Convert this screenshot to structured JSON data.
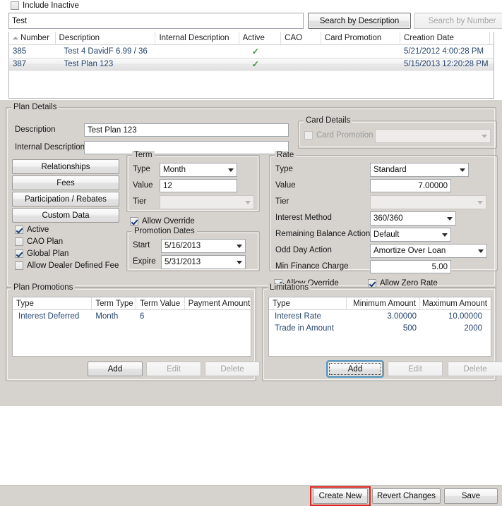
{
  "top": {
    "include_inactive_label": "Include Inactive",
    "include_inactive_checked": false,
    "search_value": "Test",
    "search_placeholder": "",
    "search_by_description_label": "Search by Description",
    "search_by_number_label": "Search by Number"
  },
  "results_grid": {
    "columns": [
      "Number",
      "Description",
      "Internal Description",
      "Active",
      "CAO",
      "Card Promotion",
      "Creation Date"
    ],
    "sort_column": "Number",
    "sort_direction": "ascending",
    "rows": [
      {
        "number": "385",
        "description": "Test 4 DavidF 6.99 / 36",
        "internal_description": "",
        "active": "✓",
        "cao": "",
        "card_promotion": "",
        "creation_date": "5/21/2012 4:00:28 PM",
        "selected": false
      },
      {
        "number": "387",
        "description": "Test Plan 123",
        "internal_description": "",
        "active": "✓",
        "cao": "",
        "card_promotion": "",
        "creation_date": "5/15/2013 12:20:28 PM",
        "selected": true
      }
    ]
  },
  "plan_details": {
    "title": "Plan Details",
    "description_label": "Description",
    "description_value": "Test Plan 123",
    "internal_description_label": "Internal Description",
    "internal_description_value": "",
    "buttons": [
      {
        "label": "Relationships"
      },
      {
        "label": "Fees"
      },
      {
        "label": "Participation / Rebates"
      },
      {
        "label": "Custom Data"
      }
    ],
    "checkboxes": [
      {
        "label": "Active",
        "checked": true
      },
      {
        "label": "CAO Plan",
        "checked": false
      },
      {
        "label": "Global Plan",
        "checked": true
      },
      {
        "label": "Allow Dealer Defined Fee",
        "checked": false
      }
    ]
  },
  "card_details": {
    "title": "Card Details",
    "card_promotion_label": "Card Promotion",
    "card_promotion_checked": false,
    "card_promotion_value": "",
    "disabled": true
  },
  "term": {
    "title": "Term",
    "type_label": "Type",
    "type_value": "Month",
    "value_label": "Value",
    "value_value": "12",
    "tier_label": "Tier",
    "tier_value": "",
    "tier_disabled": true,
    "allow_override_label": "Allow Override",
    "allow_override_checked": true
  },
  "promotion_dates": {
    "title": "Promotion Dates",
    "start_label": "Start",
    "start_value": "5/16/2013",
    "expire_label": "Expire",
    "expire_value": "5/31/2013"
  },
  "rate": {
    "title": "Rate",
    "type_label": "Type",
    "type_value": "Standard",
    "value_label": "Value",
    "value_value": "7.00000",
    "tier_label": "Tier",
    "tier_value": "",
    "tier_disabled": true,
    "interest_method_label": "Interest Method",
    "interest_method_value": "360/360",
    "remaining_balance_action_label": "Remaining Balance Action",
    "remaining_balance_action_value": "Default",
    "odd_day_action_label": "Odd Day Action",
    "odd_day_action_value": "Amortize Over Loan",
    "min_finance_charge_label": "Min Finance Charge",
    "min_finance_charge_value": "5.00",
    "allow_override_label": "Allow Override",
    "allow_override_checked": true,
    "allow_zero_rate_label": "Allow Zero Rate",
    "allow_zero_rate_checked": true
  },
  "plan_promotions": {
    "title": "Plan Promotions",
    "columns": [
      "Type",
      "Term Type",
      "Term Value",
      "Payment Amount"
    ],
    "rows": [
      {
        "type": "Interest Deferred",
        "term_type": "Month",
        "term_value": "6",
        "payment_amount": ""
      }
    ],
    "add_label": "Add",
    "edit_label": "Edit",
    "delete_label": "Delete",
    "add_enabled": true,
    "edit_enabled": false,
    "delete_enabled": false
  },
  "limitations": {
    "title": "Limitations",
    "columns": [
      "Type",
      "Minimum Amount",
      "Maximum Amount"
    ],
    "rows": [
      {
        "type": "Interest Rate",
        "minimum_amount": "3.00000",
        "maximum_amount": "10.00000"
      },
      {
        "type": "Trade in Amount",
        "minimum_amount": "500",
        "maximum_amount": "2000"
      }
    ],
    "add_label": "Add",
    "edit_label": "Edit",
    "delete_label": "Delete",
    "add_enabled": true,
    "add_focused": true,
    "edit_enabled": false,
    "delete_enabled": false
  },
  "footer": {
    "create_new_label": "Create New",
    "revert_changes_label": "Revert Changes",
    "save_label": "Save",
    "highlight_color": "#e0241f",
    "highlighted_button": "Create New"
  }
}
